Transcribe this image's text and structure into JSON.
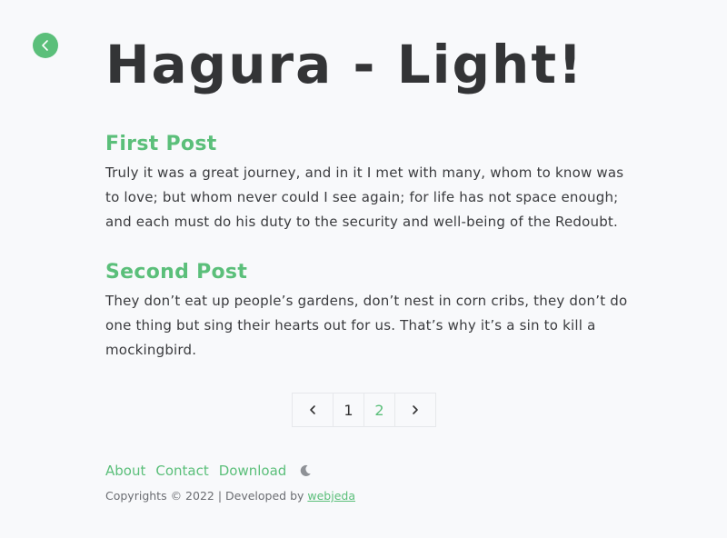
{
  "header": {
    "site_title": "Hagura - Light!",
    "back_icon": "chevron-left-icon"
  },
  "posts": [
    {
      "title": "First Post",
      "excerpt": "Truly it was a great journey, and in it I met with many, whom to know was to love; but whom never could I see again; for life has not space enough; and each must do his duty to the security and well-being of the Redoubt."
    },
    {
      "title": "Second Post",
      "excerpt": "They don’t eat up people’s gardens, don’t nest in corn cribs, they don’t do one thing but sing their hearts out for us. That’s why it’s a sin to kill a mockingbird."
    }
  ],
  "pagination": {
    "prev_icon": "chevron-left-icon",
    "pages": [
      "1",
      "2"
    ],
    "current_page": "2",
    "next_icon": "chevron-right-icon"
  },
  "footer": {
    "links": [
      "About",
      "Contact",
      "Download"
    ],
    "theme_toggle_icon": "moon-icon",
    "copyright_text": "Copyrights © 2022 | Developed by",
    "developer_link": " webjeda "
  },
  "colors": {
    "accent": "#5bbf7a",
    "background": "#f8f9fb",
    "text": "#333436"
  }
}
